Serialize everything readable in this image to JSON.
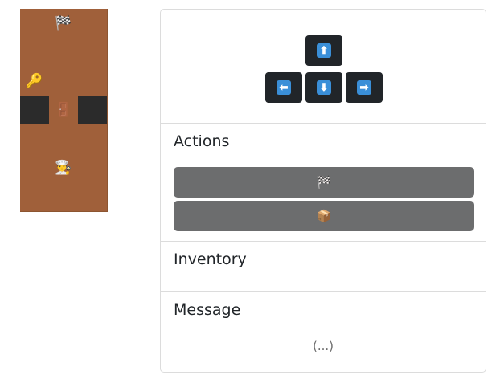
{
  "board": {
    "cells": [
      {
        "name": "goal-flag-icon",
        "glyph": "🏁",
        "type": "item",
        "col": 1,
        "row": 0
      },
      {
        "name": "key-icon",
        "glyph": "🔑",
        "type": "item",
        "col": 0,
        "row": 2
      },
      {
        "name": "wall-cell",
        "glyph": "",
        "type": "wall",
        "col": 0,
        "row": 3
      },
      {
        "name": "door-icon",
        "glyph": "🚪",
        "type": "item",
        "col": 1,
        "row": 3
      },
      {
        "name": "wall-cell",
        "glyph": "",
        "type": "wall",
        "col": 2,
        "row": 3
      },
      {
        "name": "player-icon",
        "glyph": "👨‍🍳",
        "type": "item",
        "col": 1,
        "row": 5
      }
    ]
  },
  "controls": {
    "up": "⬆",
    "left": "⬅",
    "down": "⬇",
    "right": "➡"
  },
  "actions": {
    "title": "Actions",
    "buttons": [
      {
        "name": "goal-action-button",
        "icon": "flag-icon",
        "label": "🏁"
      },
      {
        "name": "box-action-button",
        "icon": "package-icon",
        "label": "📦"
      }
    ]
  },
  "inventory": {
    "title": "Inventory"
  },
  "message": {
    "title": "Message",
    "text": "(...)"
  }
}
